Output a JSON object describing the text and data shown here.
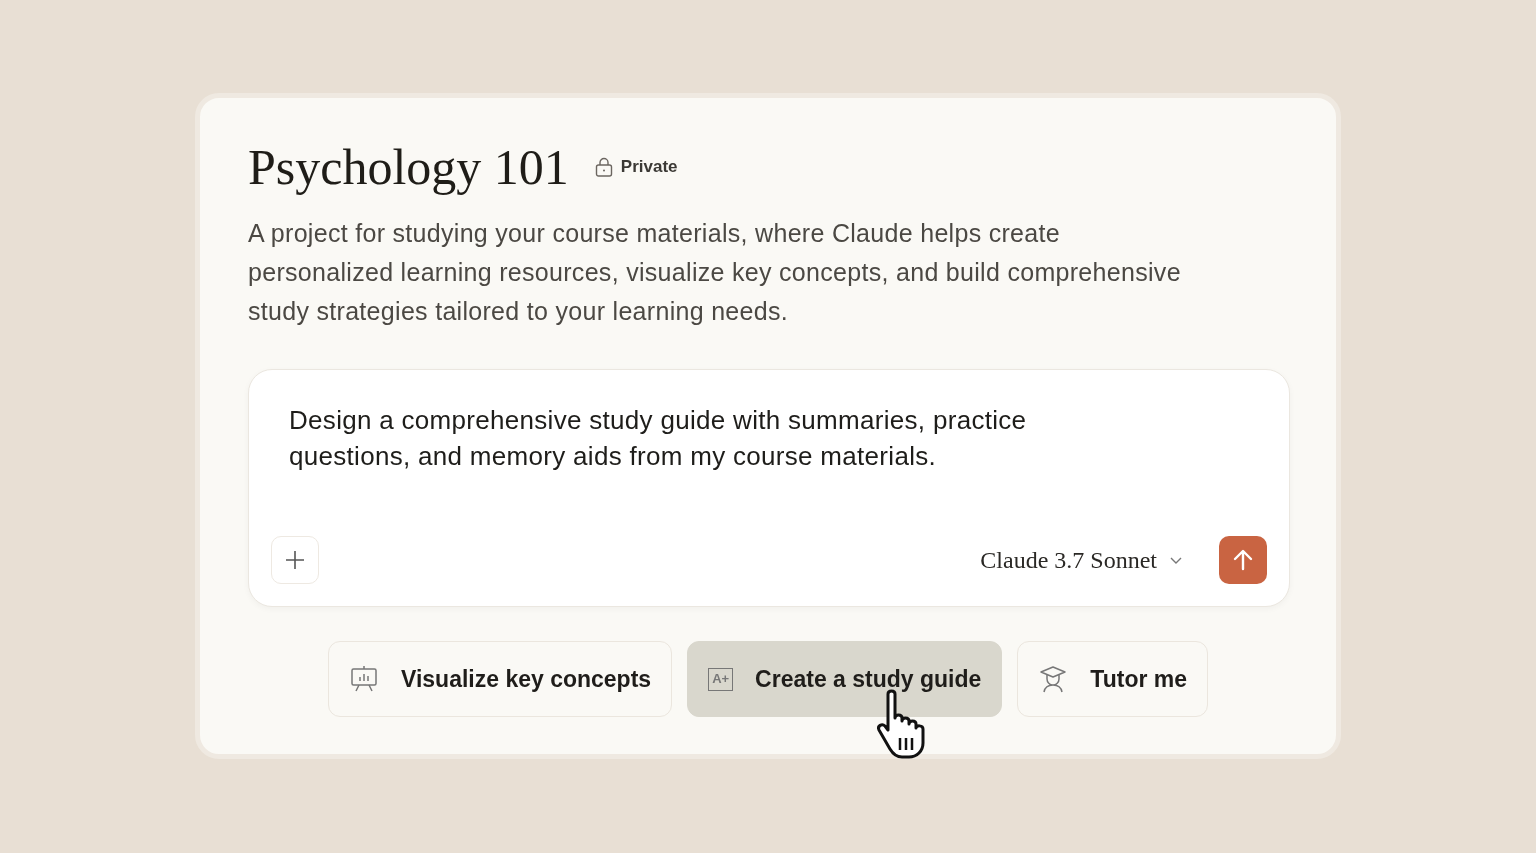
{
  "project": {
    "title": "Psychology 101",
    "visibility": "Private",
    "description": "A project for studying your course materials, where Claude helps create personalized learning resources, visualize key concepts, and build comprehensive study strategies tailored to your learning needs."
  },
  "composer": {
    "value": "Design a comprehensive study guide with summaries, practice questions, and memory aids from my course materials.",
    "model": "Claude 3.7 Sonnet"
  },
  "suggestions": [
    {
      "kind": "chart",
      "label": "Visualize key concepts",
      "selected": false
    },
    {
      "kind": "grade",
      "icon_text": "A+",
      "label": "Create a study guide",
      "selected": true
    },
    {
      "kind": "tutor",
      "label": "Tutor me",
      "selected": false
    }
  ]
}
